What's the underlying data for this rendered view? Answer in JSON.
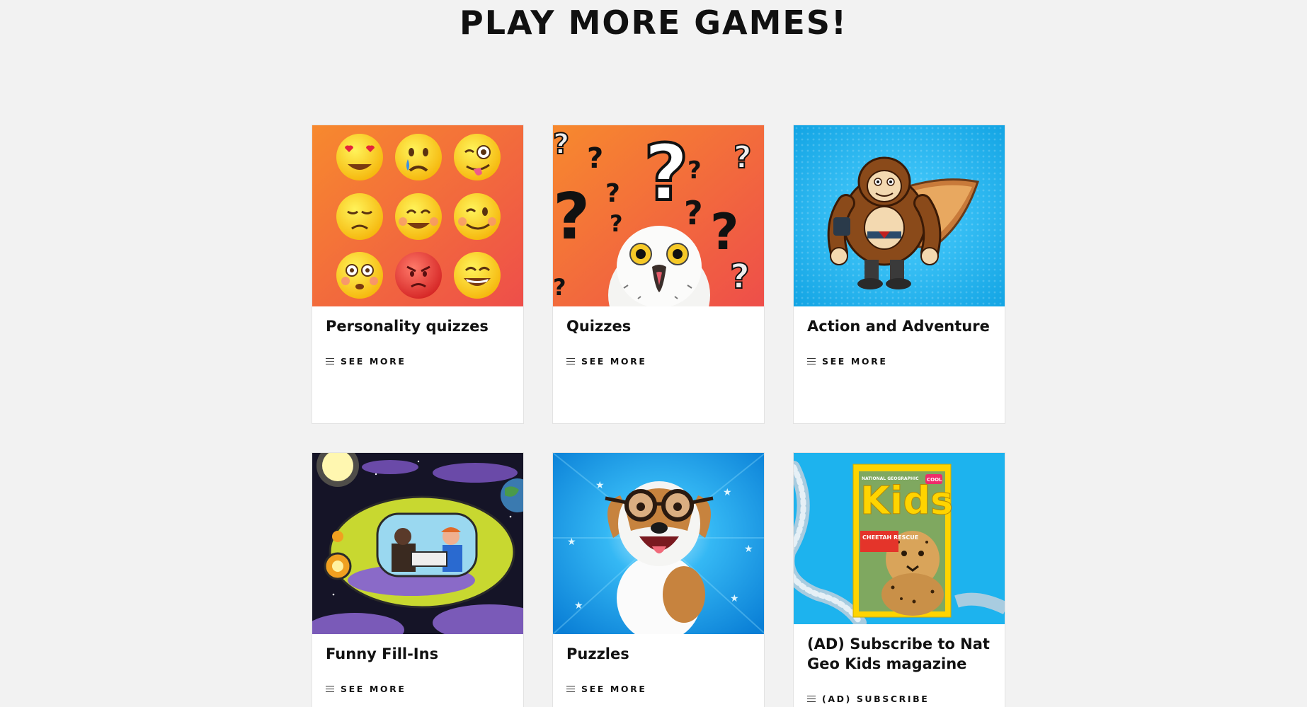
{
  "section_heading": "PLAY MORE GAMES!",
  "cards": [
    {
      "title": "Personality quizzes",
      "link_label": "SEE MORE",
      "image_icon": "emoji-faces-icon"
    },
    {
      "title": "Quizzes",
      "link_label": "SEE MORE",
      "image_icon": "owl-question-marks-icon"
    },
    {
      "title": "Action and Adventure",
      "link_label": "SEE MORE",
      "image_icon": "caped-ape-hero-icon"
    },
    {
      "title": "Funny Fill-Ins",
      "link_label": "SEE MORE",
      "image_icon": "space-ship-icon"
    },
    {
      "title": "Puzzles",
      "link_label": "SEE MORE",
      "image_icon": "dog-with-glasses-icon"
    },
    {
      "title": "(AD) Subscribe to Nat Geo Kids magazine",
      "link_label": "(AD) SUBSCRIBE",
      "image_icon": "magazine-cover-icon"
    }
  ],
  "magazine_cover": {
    "brand": "NATIONAL GEOGRAPHIC",
    "masthead": "Kids",
    "cover_line": "CHEETAH RESCUE",
    "badge": "COOL"
  },
  "colors": {
    "page_bg": "#f2f2f2",
    "card_bg": "#ffffff",
    "text": "#111111",
    "orange": "#f26a3c",
    "sky_blue": "#1ab4ee"
  }
}
